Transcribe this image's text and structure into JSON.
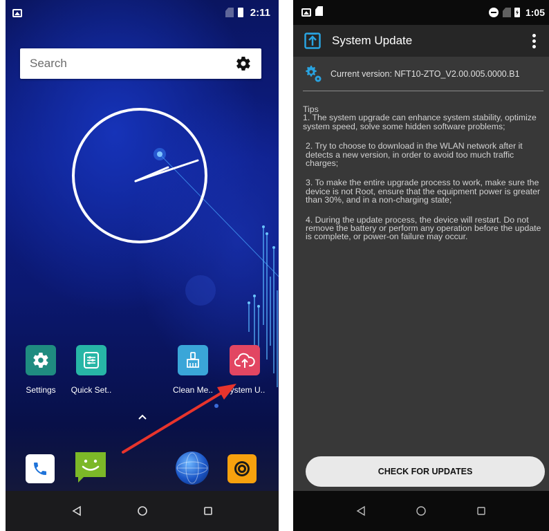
{
  "left_phone": {
    "status_bar": {
      "time": "2:11"
    },
    "search": {
      "placeholder": "Search"
    },
    "apps": [
      {
        "label": "Settings",
        "icon": "settings-gear-icon"
      },
      {
        "label": "Quick Set..",
        "icon": "quick-settings-icon"
      },
      {
        "label": "Clean Me..",
        "icon": "clean-memory-broom-icon"
      },
      {
        "label": "System U..",
        "icon": "cloud-upload-icon"
      }
    ],
    "dock": [
      {
        "icon": "phone-icon"
      },
      {
        "icon": "messaging-icon"
      },
      {
        "icon": "browser-globe-icon"
      },
      {
        "icon": "camera-icon"
      }
    ],
    "colors": {
      "settings_tile": "#1f8c80",
      "quick_tile": "#27b6a6",
      "clean_tile": "#3aa6d8",
      "system_tile": "#e24662",
      "arrow": "#e8342c"
    }
  },
  "right_phone": {
    "status_bar": {
      "time": "1:05"
    },
    "toolbar": {
      "title": "System Update"
    },
    "current_version": "Current version: NFT10-ZTO_V2.00.005.0000.B1",
    "tips_heading": "Tips",
    "tips": [
      "1. The system upgrade can enhance system stability, optimize system speed, solve some hidden software problems;",
      "2. Try to choose to download in the WLAN network after it detects a new version, in order to avoid too much traffic charges;",
      "3. To make the entire upgrade process to work, make sure the device is not Root, ensure that the equipment power is greater than 30%, and in a non-charging state;",
      "4. During the update process, the device will restart. Do not remove the battery or perform any operation before the update is complete, or power-on failure may occur."
    ],
    "check_button": "CHECK FOR UPDATES",
    "colors": {
      "accent": "#29a3e0",
      "background": "#383838"
    }
  }
}
